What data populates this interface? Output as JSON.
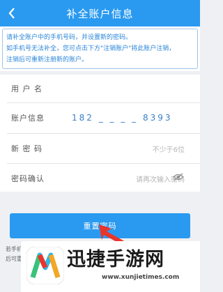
{
  "header": {
    "title": "补全账户信息"
  },
  "notice": {
    "lines": [
      "请补全账户中的手机号码，并设置新的密码。",
      "如手机号无法补全，您可点击下方\"注销账户\"将此账户注销，",
      "注销后可重新注册新的账户。"
    ]
  },
  "form": {
    "username": {
      "label": "用 户 名",
      "value": ""
    },
    "account": {
      "label": "账户信息",
      "value": "182 _ _ _ _ 8393"
    },
    "new_password": {
      "label": "新 密 码",
      "placeholder": "不少于6位"
    },
    "confirm_password": {
      "label": "密码确认",
      "placeholder": "请再次输入密码"
    }
  },
  "submit": {
    "label": "重置密码"
  },
  "footer": {
    "line1": "若手机",
    "line2": "后可重"
  },
  "watermark": {
    "name": "迅捷手游网",
    "url": "www.xunjietimes.com"
  },
  "colors": {
    "accent": "#2a9af0",
    "pointer": "#e8352c"
  }
}
